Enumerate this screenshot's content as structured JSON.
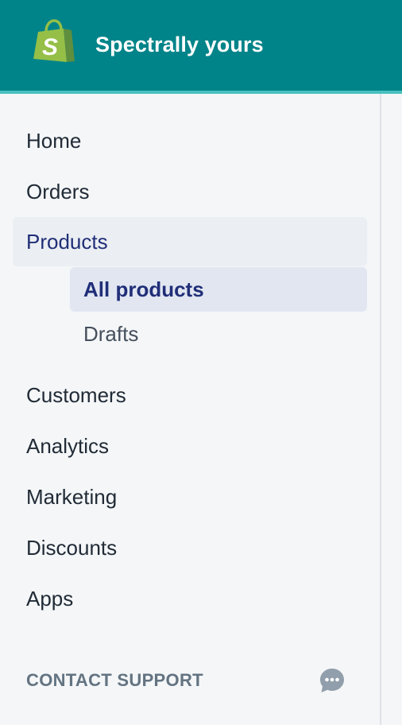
{
  "header": {
    "store_name": "Spectrally yours",
    "logo_icon": "shopify-bag-icon",
    "brand_color": "#008489",
    "accent_color": "#47c1bf"
  },
  "nav": {
    "home": "Home",
    "orders": "Orders",
    "products": "Products",
    "products_sub": {
      "all_products": "All products",
      "drafts": "Drafts"
    },
    "customers": "Customers",
    "analytics": "Analytics",
    "marketing": "Marketing",
    "discounts": "Discounts",
    "apps": "Apps"
  },
  "footer": {
    "contact_support": "CONTACT SUPPORT",
    "chat_icon": "chat-bubble-icon"
  },
  "state": {
    "active_section": "Products",
    "selected_subitem": "All products",
    "active_text_color": "#202e78"
  }
}
